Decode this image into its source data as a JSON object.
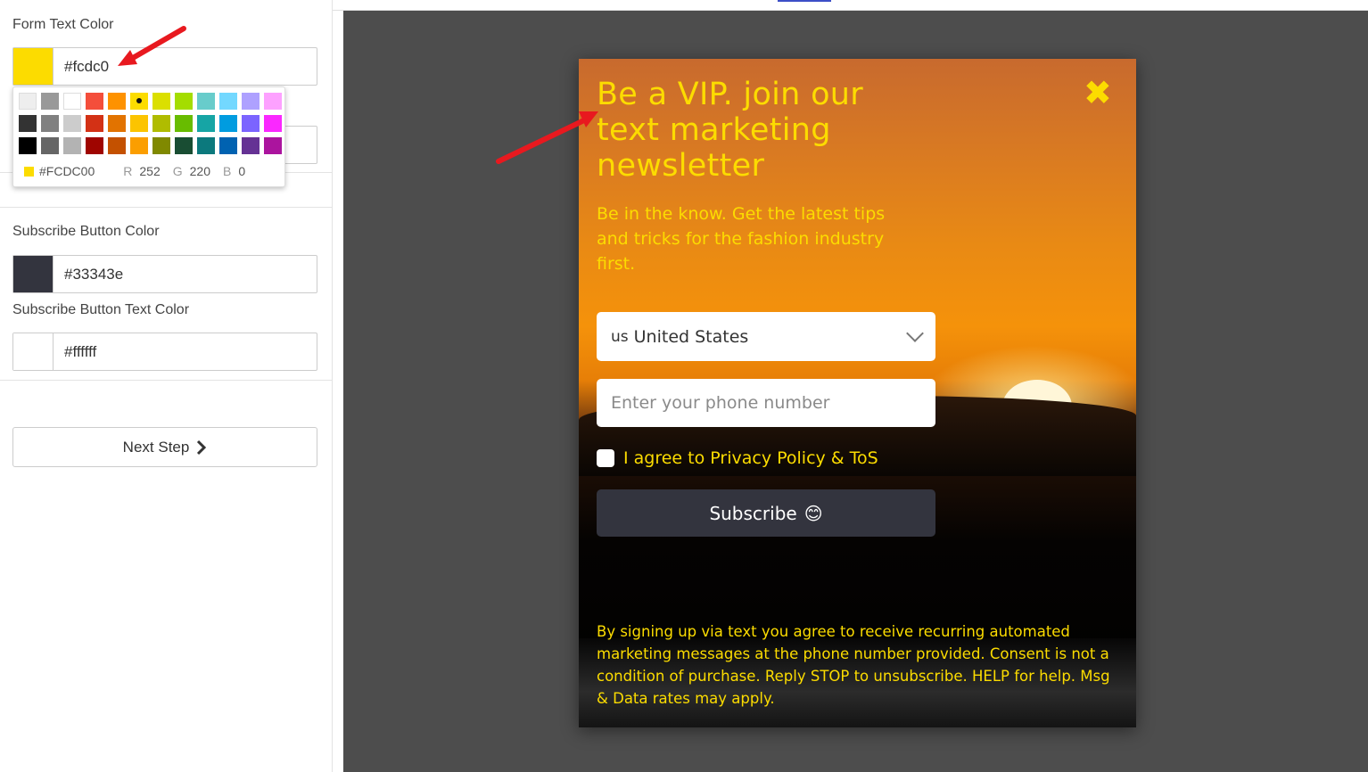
{
  "settings": {
    "form_text_color": {
      "label": "Form Text Color",
      "value": "#fcdc0",
      "swatch": "#fcdc00"
    },
    "subscribe_button_color": {
      "label": "Subscribe Button Color",
      "value": "#33343e",
      "swatch": "#33343e"
    },
    "subscribe_button_text_color": {
      "label": "Subscribe Button Text Color",
      "value": "#ffffff",
      "swatch": "#ffffff"
    },
    "next_step_label": "Next Step"
  },
  "color_picker": {
    "palette": [
      "#eeeeee",
      "#999999",
      "#ffffff",
      "#f44e3b",
      "#fe9200",
      "#fcdc00",
      "#dbdf00",
      "#a4dd00",
      "#68cccb",
      "#73d8ff",
      "#aea1ff",
      "#fda1ff",
      "#333333",
      "#808080",
      "#cccccc",
      "#d33115",
      "#e27300",
      "#fcc400",
      "#b0bc00",
      "#68bc00",
      "#16a5a5",
      "#009ce0",
      "#7b64ff",
      "#fa28ff",
      "#000000",
      "#666666",
      "#b3b3b3",
      "#9f0500",
      "#c45100",
      "#fb9e00",
      "#808900",
      "#194d33",
      "#0c797d",
      "#0062b1",
      "#653294",
      "#ab149e"
    ],
    "selected": "#fcdc00",
    "hex": "#FCDC00",
    "r_label": "R",
    "r": "252",
    "g_label": "G",
    "g": "220",
    "b_label": "B",
    "b": "0"
  },
  "popup": {
    "title": "Be a VIP. join our text marketing newsletter",
    "close_glyph": "✖",
    "subtitle": "Be in the know. Get the latest tips and tricks for the fashion industry first.",
    "country_code": "us",
    "country": "United States",
    "phone_placeholder": "Enter your phone number",
    "agree_text": "I agree to Privacy Policy & ToS",
    "subscribe_label": "Subscribe",
    "subscribe_emoji": "😊",
    "legal": "By signing up via text you agree to receive recurring automated marketing messages at the phone number provided. Consent is not a condition of purchase. Reply STOP to unsubscribe. HELP for help. Msg & Data rates may apply.",
    "text_color": "#fcdc00",
    "button_color": "#33343e"
  },
  "icons": {
    "close": "close-icon",
    "chevron": "chevron-down-icon",
    "next": "chevron-right-icon",
    "arrow": "annotation-arrow-icon"
  }
}
